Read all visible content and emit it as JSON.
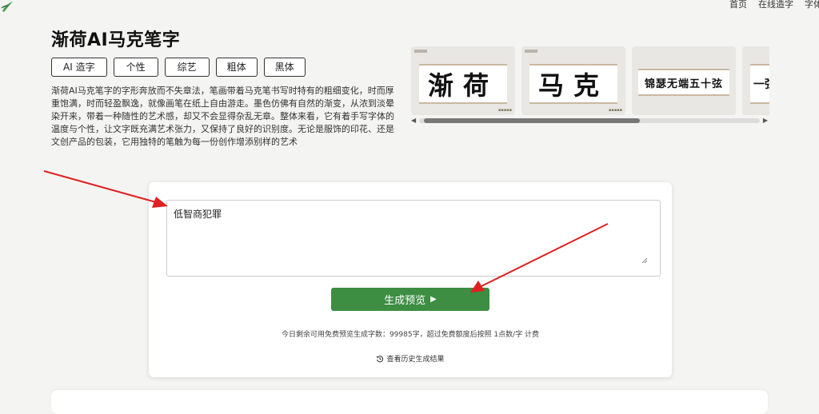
{
  "topnav": [
    "首页",
    "在线造字",
    "字体"
  ],
  "page_title": "渐荷AI马克笔字",
  "tags": [
    "AI 造字",
    "个性",
    "综艺",
    "粗体",
    "黑体"
  ],
  "description": "渐荷AI马克笔字的字形奔放而不失章法，笔画带着马克笔书写时特有的粗细变化，时而厚重饱满，时而轻盈飘逸，就像画笔在纸上自由游走。墨色仿佛有自然的渐变，从浓到淡晕染开来，带着一种随性的艺术感，却又不会显得杂乱无章。整体来看，它有着手写字体的温度与个性，让文字既充满艺术张力，又保持了良好的识别度。无论是服饰的印花、还是文创产品的包装，它用独特的笔触为每一份创作增添别样的艺术",
  "samples": [
    "渐荷",
    "马克",
    "锦瑟无端五十弦",
    "一弦"
  ],
  "input": {
    "value": "低智商犯罪"
  },
  "generate_label": "生成预览",
  "quota_text": "今日剩余可用免费预览生成字数：99985字，超过免费额度后按照 1点数/字 计费",
  "history_text": "查看历史生成结果",
  "colors": {
    "primary_button": "#3d8d43",
    "annotation_arrow": "#e02020"
  }
}
